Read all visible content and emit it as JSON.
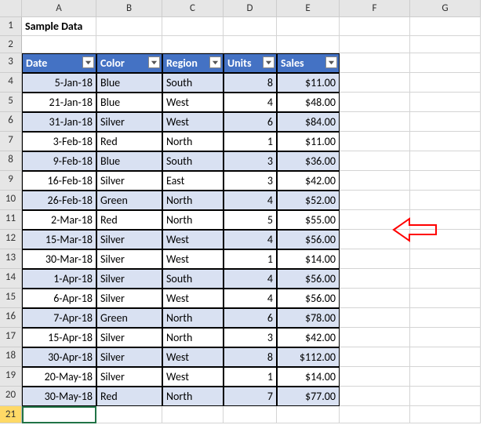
{
  "columns": [
    "A",
    "B",
    "C",
    "D",
    "E",
    "F",
    "G"
  ],
  "row_count": 21,
  "title_cell": "Sample Data",
  "headers": [
    "Date",
    "Color",
    "Region",
    "Units",
    "Sales"
  ],
  "rows": [
    {
      "date": "5-Jan-18",
      "color": "Blue",
      "region": "South",
      "units": "8",
      "sales": "$11.00"
    },
    {
      "date": "21-Jan-18",
      "color": "Blue",
      "region": "West",
      "units": "4",
      "sales": "$48.00"
    },
    {
      "date": "31-Jan-18",
      "color": "Silver",
      "region": "West",
      "units": "6",
      "sales": "$84.00"
    },
    {
      "date": "3-Feb-18",
      "color": "Red",
      "region": "North",
      "units": "1",
      "sales": "$11.00"
    },
    {
      "date": "9-Feb-18",
      "color": "Blue",
      "region": "South",
      "units": "3",
      "sales": "$36.00"
    },
    {
      "date": "16-Feb-18",
      "color": "Silver",
      "region": "East",
      "units": "3",
      "sales": "$42.00"
    },
    {
      "date": "26-Feb-18",
      "color": "Green",
      "region": "North",
      "units": "4",
      "sales": "$52.00"
    },
    {
      "date": "2-Mar-18",
      "color": "Red",
      "region": "North",
      "units": "5",
      "sales": "$55.00"
    },
    {
      "date": "15-Mar-18",
      "color": "Silver",
      "region": "West",
      "units": "4",
      "sales": "$56.00"
    },
    {
      "date": "30-Mar-18",
      "color": "Silver",
      "region": "West",
      "units": "1",
      "sales": "$14.00"
    },
    {
      "date": "1-Apr-18",
      "color": "Silver",
      "region": "South",
      "units": "4",
      "sales": "$56.00"
    },
    {
      "date": "6-Apr-18",
      "color": "Silver",
      "region": "West",
      "units": "4",
      "sales": "$56.00"
    },
    {
      "date": "7-Apr-18",
      "color": "Green",
      "region": "North",
      "units": "6",
      "sales": "$78.00"
    },
    {
      "date": "15-Apr-18",
      "color": "Silver",
      "region": "North",
      "units": "3",
      "sales": "$42.00"
    },
    {
      "date": "30-Apr-18",
      "color": "Silver",
      "region": "West",
      "units": "8",
      "sales": "$112.00"
    },
    {
      "date": "20-May-18",
      "color": "Silver",
      "region": "West",
      "units": "1",
      "sales": "$14.00"
    },
    {
      "date": "30-May-18",
      "color": "Red",
      "region": "North",
      "units": "7",
      "sales": "$77.00"
    }
  ],
  "chart_data": {
    "type": "table",
    "title": "Sample Data",
    "columns": [
      "Date",
      "Color",
      "Region",
      "Units",
      "Sales"
    ],
    "records": [
      [
        "5-Jan-18",
        "Blue",
        "South",
        8,
        11.0
      ],
      [
        "21-Jan-18",
        "Blue",
        "West",
        4,
        48.0
      ],
      [
        "31-Jan-18",
        "Silver",
        "West",
        6,
        84.0
      ],
      [
        "3-Feb-18",
        "Red",
        "North",
        1,
        11.0
      ],
      [
        "9-Feb-18",
        "Blue",
        "South",
        3,
        36.0
      ],
      [
        "16-Feb-18",
        "Silver",
        "East",
        3,
        42.0
      ],
      [
        "26-Feb-18",
        "Green",
        "North",
        4,
        52.0
      ],
      [
        "2-Mar-18",
        "Red",
        "North",
        5,
        55.0
      ],
      [
        "15-Mar-18",
        "Silver",
        "West",
        4,
        56.0
      ],
      [
        "30-Mar-18",
        "Silver",
        "West",
        1,
        14.0
      ],
      [
        "1-Apr-18",
        "Silver",
        "South",
        4,
        56.0
      ],
      [
        "6-Apr-18",
        "Silver",
        "West",
        4,
        56.0
      ],
      [
        "7-Apr-18",
        "Green",
        "North",
        6,
        78.0
      ],
      [
        "15-Apr-18",
        "Silver",
        "North",
        3,
        42.0
      ],
      [
        "30-Apr-18",
        "Silver",
        "West",
        8,
        112.0
      ],
      [
        "20-May-18",
        "Silver",
        "West",
        1,
        14.0
      ],
      [
        "30-May-18",
        "Red",
        "North",
        7,
        77.0
      ]
    ]
  },
  "annotation": {
    "kind": "arrow-left",
    "color": "#ff0000"
  }
}
